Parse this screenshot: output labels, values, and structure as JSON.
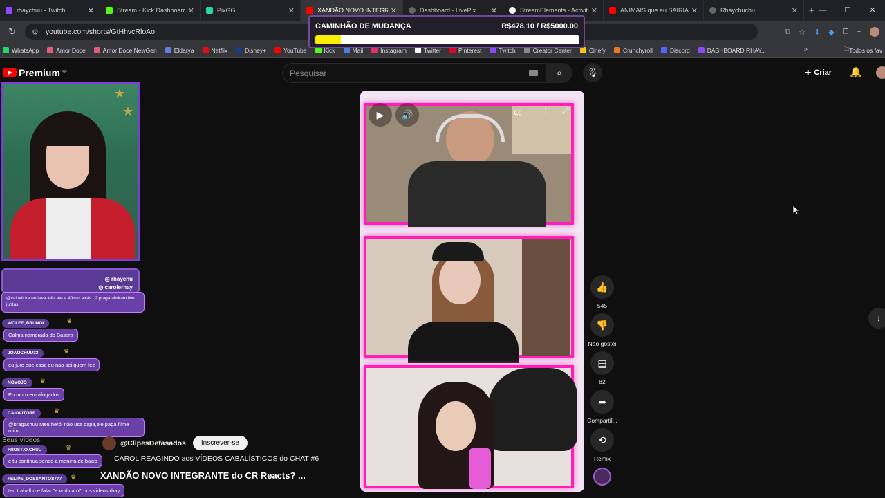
{
  "browser": {
    "tabs": [
      {
        "title": "rhaychuu - Twitch",
        "color": "#9146ff",
        "active": false
      },
      {
        "title": "Stream - Kick Dashboard",
        "color": "#53fc18",
        "active": false
      },
      {
        "title": "PixGG",
        "color": "#2bd4a8",
        "active": false
      },
      {
        "title": "XANDÃO NOVO INTEGRANTE",
        "color": "#ff0000",
        "active": true
      },
      {
        "title": "Dashboard - LivePix",
        "color": "#d0d0d0",
        "active": false
      },
      {
        "title": "StreamElements - Activity",
        "color": "#ffffff",
        "active": false
      },
      {
        "title": "ANIMAIS que eu SAIRIA",
        "color": "#ff0000",
        "active": false
      },
      {
        "title": "Rhaychuchu",
        "color": "#d0d0d0",
        "active": false
      }
    ],
    "new_tab": "+",
    "url": "youtube.com/shorts/GtHhvcRloAo",
    "bookmarks": [
      {
        "label": "WhatsApp",
        "color": "#25d366"
      },
      {
        "label": "Amor Doce",
        "color": "#e05a7a"
      },
      {
        "label": "Amor Doce NewGen",
        "color": "#e05a7a"
      },
      {
        "label": "Eldarya",
        "color": "#6a7adf"
      },
      {
        "label": "Netflix",
        "color": "#e50914"
      },
      {
        "label": "Disney+",
        "color": "#1e3a8a"
      },
      {
        "label": "YouTube",
        "color": "#ff0000"
      },
      {
        "label": "Kick",
        "color": "#53fc18"
      },
      {
        "label": "Mail",
        "color": "#4a7be0"
      },
      {
        "label": "Instagram",
        "color": "#e1306c"
      },
      {
        "label": "Twitter",
        "color": "#ffffff"
      },
      {
        "label": "Pinterest",
        "color": "#e60023"
      },
      {
        "label": "Twitch",
        "color": "#9146ff"
      },
      {
        "label": "Creator Center",
        "color": "#888888"
      },
      {
        "label": "Cinefy",
        "color": "#f5c518"
      },
      {
        "label": "Crunchyroll",
        "color": "#f47521"
      },
      {
        "label": "Discord",
        "color": "#5865f2"
      },
      {
        "label": "DASHBOARD RHAY...",
        "color": "#9146ff"
      }
    ],
    "all_bookmarks": "Todos os fav"
  },
  "overlay": {
    "title": "CAMINHÃO DE MUDANÇA",
    "amount": "R$478.10 / R$5000.00",
    "progress": 0.0956,
    "bar_color": "#f8ee00"
  },
  "youtube": {
    "logo": "Premium",
    "region": "BR",
    "search_placeholder": "Pesquisar",
    "create_label": "Criar",
    "channel_name": "@ClipesDefasados",
    "subscribe_label": "Inscrever-se",
    "description": "CAROL REAGINDO aos VÍDEOS CABALÍSTICOS do CHAT #6",
    "video_title": "XANDÃO NOVO INTEGRANTE do CR Reacts? ...",
    "seus_videos": "Seus vídeos",
    "actions": {
      "likes": "545",
      "dislike": "Não gostei",
      "comments": "82",
      "share": "Compartil...",
      "remix": "Remix"
    }
  },
  "stream": {
    "social": [
      "rhaychu",
      "carolerhay"
    ],
    "chat": [
      {
        "user": "",
        "text": "@caiovitore eu tava feliz ate a 40min atrás.. 2 praga abriram live juntas"
      },
      {
        "user": "WOLFF_BRUNOI",
        "text": "Calma namorada do Basara"
      },
      {
        "user": "JOAOCHUU33",
        "text": "eu juro que essa eu nao sei quem fez"
      },
      {
        "user": "NOVOJO",
        "text": "Eu moro em afogados"
      },
      {
        "user": "CAIOVITORE",
        "text": "@bragachuu Meu herói não usa capa,ele paga filme ruim"
      },
      {
        "user": "FROSTXXCHUU",
        "text": "e tu continua sendo a menina de baixo"
      },
      {
        "user": "FELIPE_DOSSANTOS777",
        "text": "teu trabalho e falar \"e vdd carol\" nos videos rhay"
      }
    ]
  }
}
